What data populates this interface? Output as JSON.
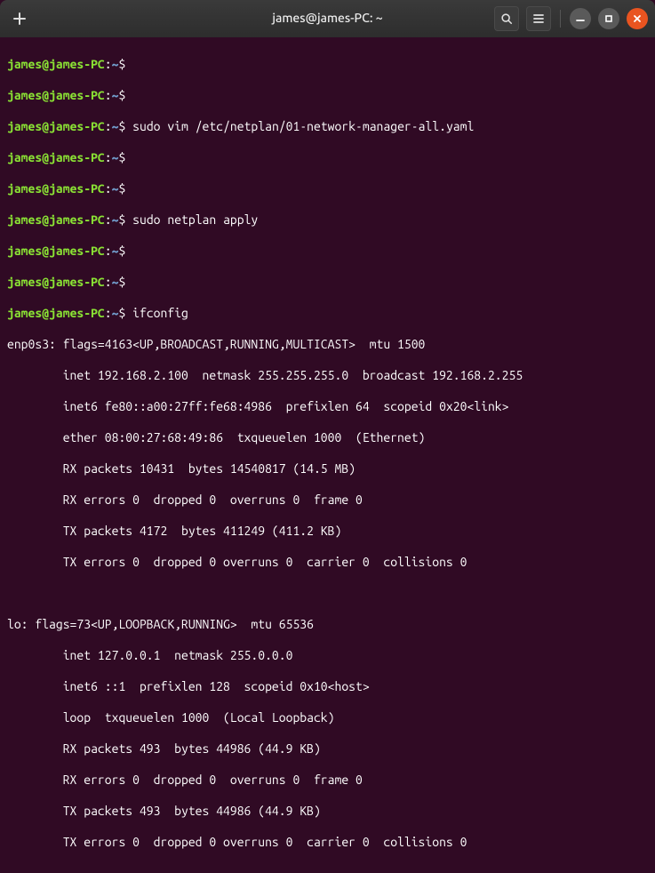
{
  "titlebar": {
    "title": "james@james-PC: ~"
  },
  "prompt": {
    "user": "james",
    "at": "@",
    "host": "james-PC",
    "colon": ":",
    "path": "~",
    "dollar": "$"
  },
  "lines": {
    "cmd1": "sudo vim /etc/netplan/01-network-manager-all.yaml",
    "cmd2": "sudo netplan apply",
    "cmd3": "ifconfig",
    "out01": "enp0s3: flags=4163<UP,BROADCAST,RUNNING,MULTICAST>  mtu 1500",
    "out02": "        inet 192.168.2.100  netmask 255.255.255.0  broadcast 192.168.2.255",
    "out03": "        inet6 fe80::a00:27ff:fe68:4986  prefixlen 64  scopeid 0x20<link>",
    "out04": "        ether 08:00:27:68:49:86  txqueuelen 1000  (Ethernet)",
    "out05": "        RX packets 10431  bytes 14540817 (14.5 MB)",
    "out06": "        RX errors 0  dropped 0  overruns 0  frame 0",
    "out07": "        TX packets 4172  bytes 411249 (411.2 KB)",
    "out08": "        TX errors 0  dropped 0 overruns 0  carrier 0  collisions 0",
    "out09": "lo: flags=73<UP,LOOPBACK,RUNNING>  mtu 65536",
    "out10": "        inet 127.0.0.1  netmask 255.0.0.0",
    "out11": "        inet6 ::1  prefixlen 128  scopeid 0x10<host>",
    "out12": "        loop  txqueuelen 1000  (Local Loopback)",
    "out13": "        RX packets 493  bytes 44986 (44.9 KB)",
    "out14": "        RX errors 0  dropped 0  overruns 0  frame 0",
    "out15": "        TX packets 493  bytes 44986 (44.9 KB)",
    "out16": "        TX errors 0  dropped 0 overruns 0  carrier 0  collisions 0"
  }
}
